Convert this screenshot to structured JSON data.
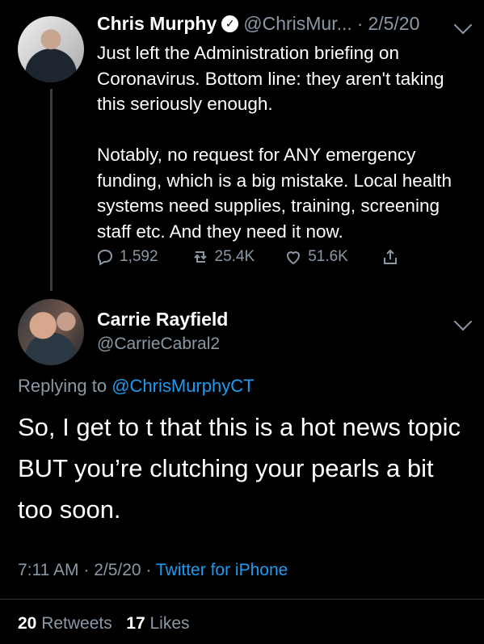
{
  "tweet": {
    "name": "Chris Murphy",
    "verified_icon": "verified-icon",
    "handle": "@ChrisMur...",
    "date_sep": "·",
    "date": "2/5/20",
    "text": "Just left the Administration briefing on Coronavirus. Bottom line: they aren't taking this seriously enough.\n\nNotably, no request for ANY emergency funding, which is a big mistake. Local health systems need supplies, training, screening staff etc. And they need it now.",
    "replies": "1,592",
    "retweets": "25.4K",
    "likes": "51.6K"
  },
  "reply": {
    "name": "Carrie Rayfield",
    "handle": "@CarrieCabral2",
    "replying_to_label": "Replying to",
    "replying_to_handle": "@ChrisMurphyCT",
    "text": "So, I get to t that this is a hot news topic BUT you’re clutching your pearls a bit too soon.",
    "time": "7:11 AM",
    "date": "2/5/20",
    "separator": "·",
    "source": "Twitter for iPhone",
    "retweet_count": "20",
    "retweet_label": "Retweets",
    "like_count": "17",
    "like_label": "Likes"
  },
  "colors": {
    "background": "#000000",
    "text": "#ffffff",
    "muted": "#8b98a5",
    "link": "#1d9bf0"
  }
}
